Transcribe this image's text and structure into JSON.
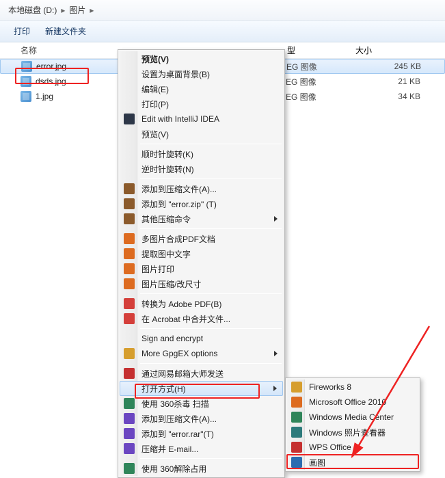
{
  "breadcrumb": {
    "part1": "本地磁盘 (D:)",
    "sep": "▸",
    "part2": "图片",
    "sep2": "▸"
  },
  "toolbar": {
    "print": "打印",
    "newfolder": "新建文件夹"
  },
  "headers": {
    "name": "名称",
    "type": "型",
    "size": "大小"
  },
  "files": [
    {
      "name": "error.jpg",
      "type": "EG 图像",
      "size": "245 KB"
    },
    {
      "name": "dsds.jpg",
      "type": "EG 图像",
      "size": "21 KB"
    },
    {
      "name": "1.jpg",
      "type": "EG 图像",
      "size": "34 KB"
    }
  ],
  "menu": {
    "preview": "预览(V)",
    "set_wallpaper": "设置为桌面背景(B)",
    "edit": "编辑(E)",
    "print": "打印(P)",
    "intellij": "Edit with IntelliJ IDEA",
    "preview2": "预览(V)",
    "rotate_cw": "顺时针旋转(K)",
    "rotate_ccw": "逆时针旋转(N)",
    "add_archive": "添加到压缩文件(A)...",
    "add_zip": "添加到 \"error.zip\" (T)",
    "other_compress": "其他压缩命令",
    "pdf_merge": "多图片合成PDF文档",
    "extract_text": "提取图中文字",
    "img_print": "图片打印",
    "img_resize": "图片压缩/改尺寸",
    "to_pdf": "转换为 Adobe PDF(B)",
    "acrobat_merge": "在 Acrobat 中合并文件...",
    "sign_encrypt": "Sign and encrypt",
    "gpgex": "More GpgEX options",
    "netease_send": "通过网易邮箱大师发送",
    "open_with": "打开方式(H)",
    "scan360": "使用 360杀毒 扫描",
    "add_rar": "添加到压缩文件(A)...",
    "add_rar2": "添加到 \"error.rar\"(T)",
    "rar_email": "压缩并 E-mail...",
    "unlock360": "使用 360解除占用"
  },
  "submenu": {
    "fireworks": "Fireworks 8",
    "msoffice": "Microsoft Office 2010",
    "wmc": "Windows Media Center",
    "photo_viewer": "Windows 照片查看器",
    "wps": "WPS Office",
    "paint": "画图"
  }
}
